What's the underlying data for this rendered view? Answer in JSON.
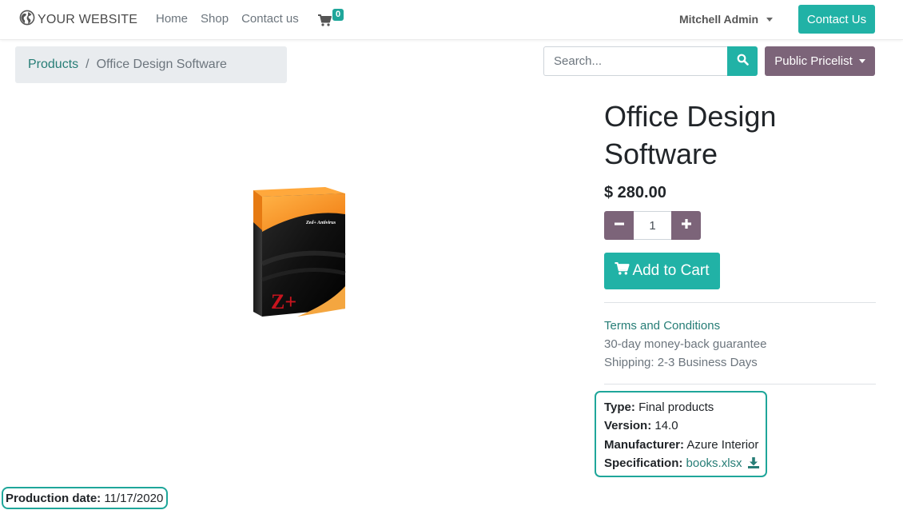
{
  "header": {
    "logo_text": "YOUR WEBSITE",
    "nav": [
      "Home",
      "Shop",
      "Contact us"
    ],
    "cart_count": "0",
    "user_name": "Mitchell Admin",
    "contact_button": "Contact Us"
  },
  "breadcrumb": {
    "parent": "Products",
    "separator": "/",
    "current": "Office Design Software"
  },
  "search": {
    "placeholder": "Search...",
    "pricelist_label": "Public Pricelist"
  },
  "product": {
    "title": "Office Design Software",
    "price": "$ 280.00",
    "quantity": "1",
    "add_to_cart_label": "Add to Cart",
    "box_brand_text": "Zed+ Antivirus",
    "box_logo_text": "Z+"
  },
  "terms": {
    "link": "Terms and Conditions",
    "lines": [
      "30-day money-back guarantee",
      "Shipping: 2-3 Business Days"
    ]
  },
  "attributes": [
    {
      "label": "Type:",
      "value": "Final products"
    },
    {
      "label": "Version:",
      "value": "14.0"
    },
    {
      "label": "Manufacturer:",
      "value": "Azure Interior"
    },
    {
      "label": "Specification:",
      "value": "books.xlsx"
    }
  ],
  "production": {
    "label": "Production date:",
    "value": "11/17/2020"
  },
  "colors": {
    "primary": "#21b2a6",
    "secondary": "#7c6479",
    "link": "#267d76",
    "highlight_border": "#1fa69a"
  },
  "icons": [
    "globe-icon",
    "cart-icon",
    "search-icon",
    "minus-icon",
    "plus-icon",
    "download-icon"
  ]
}
